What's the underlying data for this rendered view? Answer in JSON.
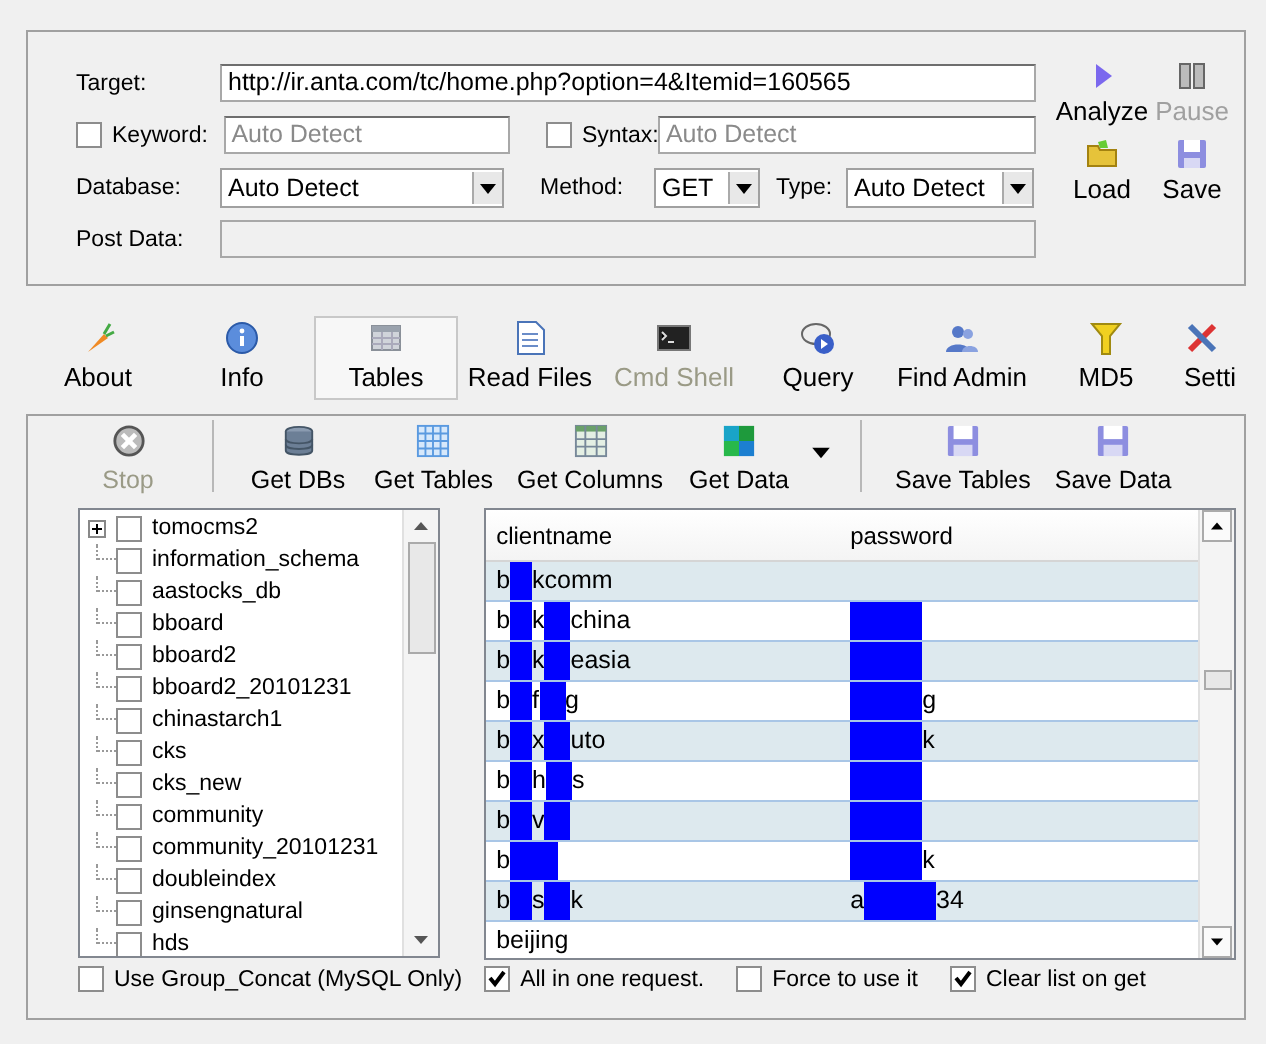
{
  "target": {
    "label": "Target:",
    "value": "http://ir.anta.com/tc/home.php?option=4&Itemid=160565"
  },
  "keyword": {
    "label": "Keyword:",
    "checked": false,
    "value": "Auto Detect",
    "disabled": true
  },
  "syntax": {
    "label": "Syntax:",
    "checked": false,
    "value": "Auto Detect",
    "disabled": true
  },
  "database": {
    "label": "Database:",
    "value": "Auto Detect"
  },
  "method": {
    "label": "Method:",
    "value": "GET"
  },
  "type": {
    "label": "Type:",
    "value": "Auto Detect"
  },
  "post_data": {
    "label": "Post Data:",
    "disabled": true
  },
  "actions": [
    {
      "label": "Analyze",
      "disabled": false
    },
    {
      "label": "Pause",
      "disabled": true
    },
    {
      "label": "Load",
      "disabled": false
    },
    {
      "label": "Save",
      "disabled": false
    }
  ],
  "tabs": [
    {
      "label": "About",
      "selected": false,
      "disabled": false
    },
    {
      "label": "Info",
      "selected": false,
      "disabled": false
    },
    {
      "label": "Tables",
      "selected": true,
      "disabled": false
    },
    {
      "label": "Read Files",
      "selected": false,
      "disabled": false
    },
    {
      "label": "Cmd Shell",
      "selected": false,
      "disabled": true
    },
    {
      "label": "Query",
      "selected": false,
      "disabled": false
    },
    {
      "label": "Find Admin",
      "selected": false,
      "disabled": false
    },
    {
      "label": "MD5",
      "selected": false,
      "disabled": false
    },
    {
      "label": "Setti",
      "selected": false,
      "disabled": false
    }
  ],
  "toolbar": [
    {
      "kind": "button",
      "label": "Stop",
      "disabled": true
    },
    {
      "kind": "separator"
    },
    {
      "kind": "button",
      "label": "Get DBs",
      "disabled": false
    },
    {
      "kind": "button",
      "label": "Get Tables",
      "disabled": false
    },
    {
      "kind": "button",
      "label": "Get Columns",
      "disabled": false
    },
    {
      "kind": "button",
      "label": "Get Data",
      "disabled": false
    },
    {
      "kind": "dropdown"
    },
    {
      "kind": "separator"
    },
    {
      "kind": "button",
      "label": "Save Tables",
      "disabled": false
    },
    {
      "kind": "button",
      "label": "Save Data",
      "disabled": false
    }
  ],
  "tree": {
    "items": [
      {
        "label": "tomocms2",
        "checked": false,
        "expandable": true
      },
      {
        "label": "information_schema",
        "checked": false,
        "expandable": false
      },
      {
        "label": "aastocks_db",
        "checked": false,
        "expandable": false
      },
      {
        "label": "bboard",
        "checked": false,
        "expandable": false
      },
      {
        "label": "bboard2",
        "checked": false,
        "expandable": false
      },
      {
        "label": "bboard2_20101231",
        "checked": false,
        "expandable": false
      },
      {
        "label": "chinastarch1",
        "checked": false,
        "expandable": false
      },
      {
        "label": "cks",
        "checked": false,
        "expandable": false
      },
      {
        "label": "cks_new",
        "checked": false,
        "expandable": false
      },
      {
        "label": "community",
        "checked": false,
        "expandable": false
      },
      {
        "label": "community_20101231",
        "checked": false,
        "expandable": false
      },
      {
        "label": "doubleindex",
        "checked": false,
        "expandable": false
      },
      {
        "label": "ginsengnatural",
        "checked": false,
        "expandable": false
      },
      {
        "label": "hds",
        "checked": false,
        "expandable": false
      }
    ]
  },
  "group_concat": {
    "label": "Use Group_Concat (MySQL Only)",
    "checked": false
  },
  "table": {
    "columns": [
      "clientname",
      "password"
    ],
    "rows": [
      [
        [
          {
            "kind": "text",
            "text": "b"
          },
          {
            "kind": "redaction"
          },
          {
            "kind": "text",
            "text": "kcomm"
          }
        ],
        []
      ],
      [
        [
          {
            "kind": "text",
            "text": "b"
          },
          {
            "kind": "redaction"
          },
          {
            "kind": "text",
            "text": "k"
          },
          {
            "kind": "redaction"
          },
          {
            "kind": "text",
            "text": "china"
          }
        ],
        [
          {
            "kind": "redaction"
          }
        ]
      ],
      [
        [
          {
            "kind": "text",
            "text": "b"
          },
          {
            "kind": "redaction"
          },
          {
            "kind": "text",
            "text": "k"
          },
          {
            "kind": "redaction"
          },
          {
            "kind": "text",
            "text": "easia"
          }
        ],
        [
          {
            "kind": "redaction"
          }
        ]
      ],
      [
        [
          {
            "kind": "text",
            "text": "b"
          },
          {
            "kind": "redaction"
          },
          {
            "kind": "text",
            "text": "f"
          },
          {
            "kind": "redaction"
          },
          {
            "kind": "text",
            "text": "g"
          }
        ],
        [
          {
            "kind": "redaction"
          },
          {
            "kind": "text",
            "text": "g"
          }
        ]
      ],
      [
        [
          {
            "kind": "text",
            "text": "b"
          },
          {
            "kind": "redaction"
          },
          {
            "kind": "text",
            "text": "x"
          },
          {
            "kind": "redaction"
          },
          {
            "kind": "text",
            "text": "uto"
          }
        ],
        [
          {
            "kind": "redaction"
          },
          {
            "kind": "text",
            "text": "k"
          }
        ]
      ],
      [
        [
          {
            "kind": "text",
            "text": "b"
          },
          {
            "kind": "redaction"
          },
          {
            "kind": "text",
            "text": "h"
          },
          {
            "kind": "redaction"
          },
          {
            "kind": "text",
            "text": "s"
          }
        ],
        [
          {
            "kind": "redaction"
          }
        ]
      ],
      [
        [
          {
            "kind": "text",
            "text": "b"
          },
          {
            "kind": "redaction"
          },
          {
            "kind": "text",
            "text": "v"
          },
          {
            "kind": "redaction"
          }
        ],
        [
          {
            "kind": "redaction"
          }
        ]
      ],
      [
        [
          {
            "kind": "text",
            "text": "b"
          },
          {
            "kind": "redaction"
          },
          {
            "kind": "redaction"
          }
        ],
        [
          {
            "kind": "redaction"
          },
          {
            "kind": "text",
            "text": "k"
          }
        ]
      ],
      [
        [
          {
            "kind": "text",
            "text": "b"
          },
          {
            "kind": "redaction"
          },
          {
            "kind": "text",
            "text": "s"
          },
          {
            "kind": "redaction"
          },
          {
            "kind": "text",
            "text": "k"
          }
        ],
        [
          {
            "kind": "text",
            "text": "a"
          },
          {
            "kind": "redaction"
          },
          {
            "kind": "text",
            "text": "34"
          }
        ]
      ],
      [
        [
          {
            "kind": "text",
            "text": "beijing"
          }
        ],
        []
      ]
    ]
  },
  "options": [
    {
      "label": "All in one request.",
      "checked": true
    },
    {
      "label": "Force to use it",
      "checked": false
    },
    {
      "label": "Clear list on get",
      "checked": true
    }
  ]
}
